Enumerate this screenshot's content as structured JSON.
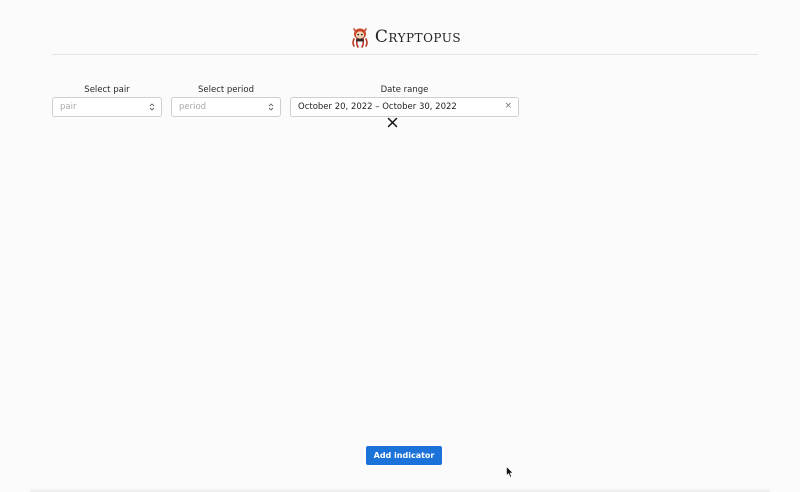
{
  "header": {
    "brand_name": "Cryptopus",
    "logo_icon": "octopus-logo-icon"
  },
  "filters": {
    "pair": {
      "label": "Select pair",
      "placeholder": "pair"
    },
    "period": {
      "label": "Select period",
      "placeholder": "period"
    },
    "date_range": {
      "label": "Date range",
      "value": "October 20, 2022 – October 30, 2022",
      "clear_glyph": "×"
    }
  },
  "actions": {
    "add_indicator_label": "Add indicator"
  },
  "colors": {
    "primary_button": "#1b73d9",
    "background": "#fbfbfb",
    "border": "#cfcfcf"
  }
}
